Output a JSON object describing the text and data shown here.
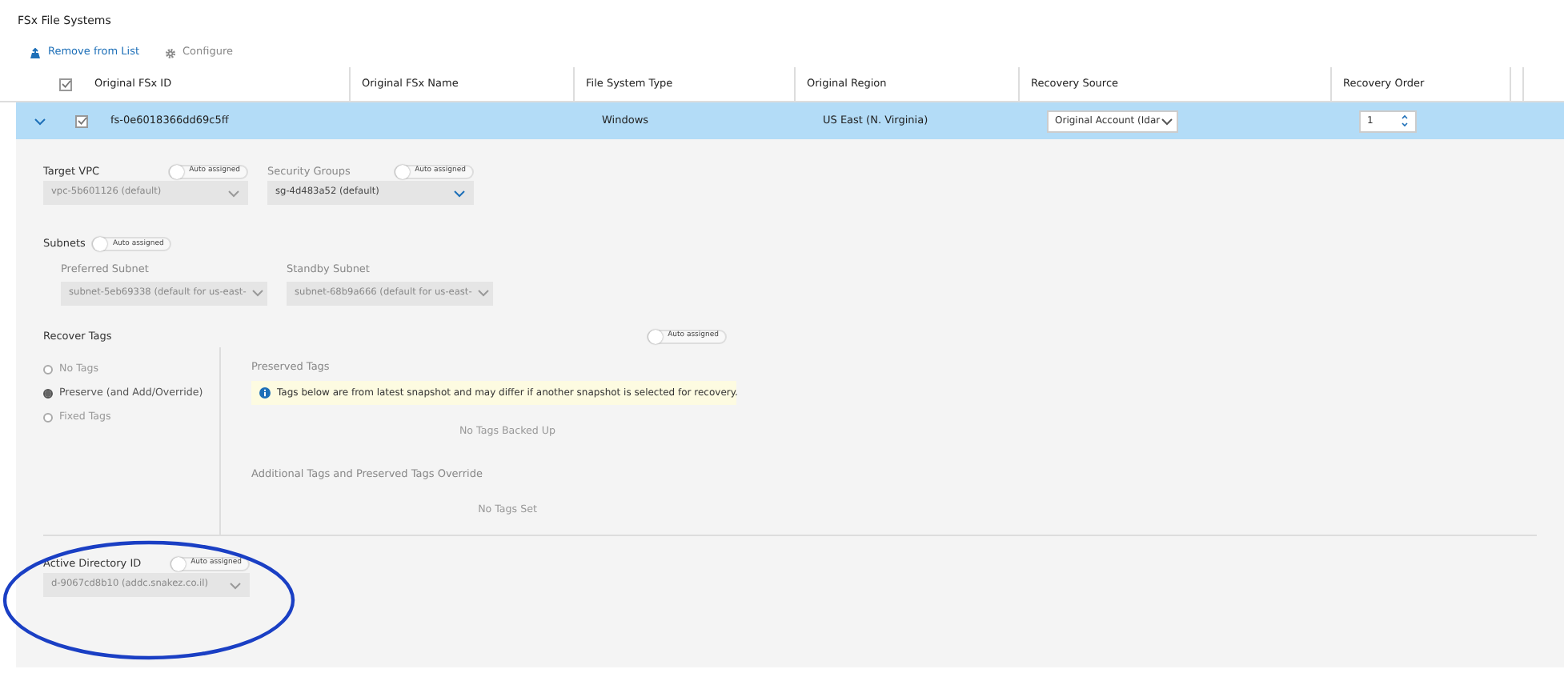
{
  "title": "FSx File Systems",
  "toolbar": [
    {
      "kind": "remove",
      "label": "Remove from List",
      "disabled": false
    },
    {
      "kind": "configure",
      "label": "Configure",
      "disabled": true
    }
  ],
  "table": {
    "select_all_checked": true,
    "columns": [
      "Original FSx ID",
      "Original FSx Name",
      "File System Type",
      "Original Region",
      "Recovery Source",
      "Recovery Order"
    ],
    "rows": [
      {
        "expanded": true,
        "selected": true,
        "checked": true,
        "id": "fs-0e6018366dd69c5ff",
        "type": "Windows",
        "region": "US East (N. Virginia)",
        "recovery_source": "Original Account (Idar",
        "recovery_order": "1"
      }
    ]
  },
  "details": {
    "target_vpc": {
      "label": "Target VPC",
      "toggle": {
        "label": "Auto assigned",
        "on": false
      },
      "value": "vpc-5b601126 (default)",
      "disabled": true
    },
    "security_groups": {
      "label": "Security Groups",
      "toggle": {
        "label": "Auto assigned",
        "on": false
      },
      "value": "sg-4d483a52 (default)",
      "disabled": false
    },
    "subnets": {
      "label": "Subnets",
      "toggle": {
        "label": "Auto assigned",
        "on": false
      },
      "fields": [
        {
          "label": "Preferred Subnet",
          "value": "subnet-5eb69338 (default for us-east-"
        },
        {
          "label": "Standby Subnet",
          "value": "subnet-68b9a666 (default for us-east-"
        }
      ]
    },
    "recover_tags": {
      "label": "Recover Tags",
      "toggle": {
        "label": "Auto assigned",
        "on": false
      },
      "options": [
        {
          "label": "No Tags",
          "selected": false
        },
        {
          "label": "Preserve (and Add/Override)",
          "selected": true
        },
        {
          "label": "Fixed Tags",
          "selected": false
        }
      ],
      "preserved_title": "Preserved Tags",
      "notice": "Tags below are from latest snapshot and may differ if another snapshot is selected for recovery.",
      "preserved_empty": "No Tags Backed Up",
      "additional_title": "Additional Tags and Preserved Tags Override",
      "additional_empty": "No Tags Set"
    },
    "active_directory": {
      "label": "Active Directory ID",
      "toggle": {
        "label": "Auto assigned",
        "on": false
      },
      "value": "d-9067cd8b10 (addc.snakez.co.il)",
      "disabled": true,
      "highlighted": true
    }
  }
}
